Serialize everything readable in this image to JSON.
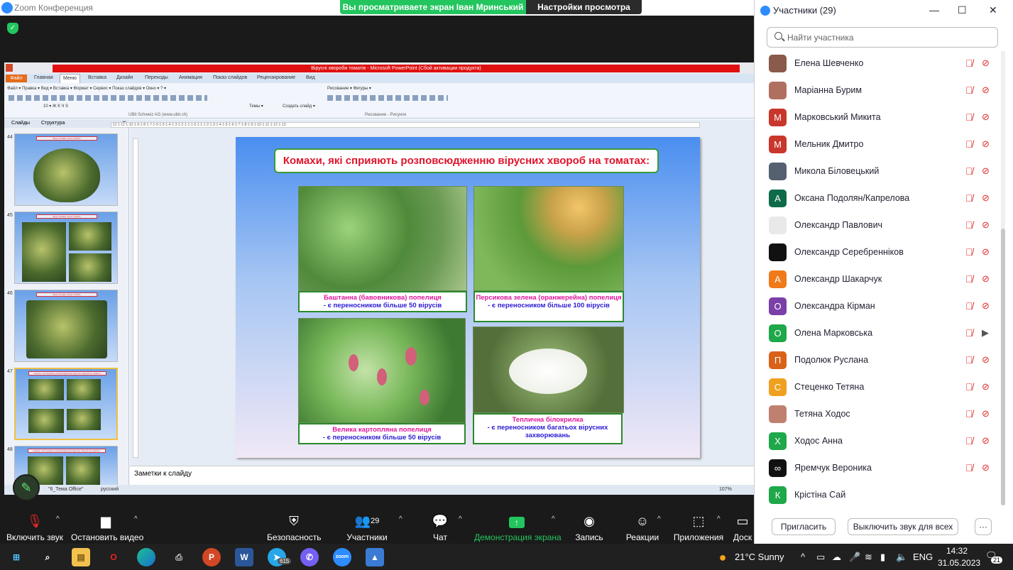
{
  "zoom": {
    "title": "Zoom Конференция",
    "banner_viewing": "Вы просматриваете экран Іван Мринський",
    "banner_settings": "Настройки просмотра"
  },
  "ppt": {
    "window_title": "Вірусні хвороби томатів  -  Microsoft PowerPoint (Сбой активации продукта)",
    "tabs": [
      "Файл",
      "Главная",
      "Меню",
      "Вставка",
      "Дизайн",
      "Переходы",
      "Анимация",
      "Показ слайдов",
      "Рецензирование",
      "Вид"
    ],
    "active_tab": "Меню",
    "menu_row": "Файл ▾   Правка ▾   Вид ▾   Вставка ▾   Формат ▾   Сервис ▾   Показ слайдов ▾   Окно ▾   ? ▾",
    "font_row": "10 ▾  Ж  К  Ч  S",
    "tools_row": "Рисование ▾     Фигуры ▾",
    "brand": "UBit Schweiz AG   (www.ubit.ch)",
    "group_drawing": "Рисование - Рисунок",
    "themes_label": "Темы ▾",
    "create_slide_label": "Создать слайд ▾",
    "pane_tab_slides": "Слайды",
    "pane_tab_structure": "Структура",
    "thumb_numbers": [
      "44",
      "45",
      "46",
      "47",
      "48"
    ],
    "thumb_header": "Вірус мозаїки пепіно (ToMV)",
    "notes_placeholder": "Заметки к слайду",
    "status_theme": "\"6_Тема Office\"",
    "status_lang": "русский",
    "status_zoom": "107%",
    "ruler": "·12·1·11·1·10·1·9·1·8·1·7·1·6·1·5·1·4·1·3·1·2·1·1·1·0·1·1·1·2·1·3·1·4·1·5·1·6·1·7·1·8·1·9·1·10·1·11·1·12·1·13·"
  },
  "slide": {
    "title": "Комахи, які сприяють розповсюдженню вірусних хвороб на томатах:",
    "captions": [
      {
        "line1": "Баштанна (бавовникова) попелиця",
        "line2": "- є переносником  більше 50 вірусів"
      },
      {
        "line1": "Персикова зелена (оранжерейна) попелиця",
        "line2": "- є переносником  більше 100 вірусів"
      },
      {
        "line1": "Велика картопляна попелиця",
        "line2": "- є переносником  більше 50 вірусів"
      },
      {
        "line1": "Теплична  білокрилка",
        "line2": "- є переносником  багатьох вірусних захворювань"
      }
    ]
  },
  "participants": {
    "title": "Участники (29)",
    "search_placeholder": "Найти участника",
    "list": [
      {
        "name": "Елена  Шевченко",
        "initial": "",
        "color": "#8a5a4a",
        "video": false
      },
      {
        "name": "Маріанна Бурим",
        "initial": "",
        "color": "#b07060",
        "video": false
      },
      {
        "name": "Марковський Микита",
        "initial": "М",
        "color": "#c9372c",
        "video": false
      },
      {
        "name": "Мельник Дмитро",
        "initial": "М",
        "color": "#c9372c",
        "video": false
      },
      {
        "name": "Микола Біловецький",
        "initial": "",
        "color": "#556070",
        "video": false
      },
      {
        "name": "Оксана Подолян/Капрелова",
        "initial": "А",
        "color": "#0e6b4a",
        "video": false
      },
      {
        "name": "Олександр Павлович",
        "initial": "",
        "color": "#e9e9e9",
        "video": false
      },
      {
        "name": "Олександр Серебренніков",
        "initial": "",
        "color": "#111111",
        "video": false
      },
      {
        "name": "Олександр Шакарчук",
        "initial": "А",
        "color": "#f07a1a",
        "video": false
      },
      {
        "name": "Олександра Кірман",
        "initial": "О",
        "color": "#7b3fa8",
        "video": false
      },
      {
        "name": "Олена Марковська",
        "initial": "О",
        "color": "#1fa84a",
        "video": true
      },
      {
        "name": "Подолюк Руслана",
        "initial": "П",
        "color": "#d9621a",
        "video": false
      },
      {
        "name": "Стеценко Тетяна",
        "initial": "С",
        "color": "#f0a020",
        "video": false
      },
      {
        "name": "Тетяна Ходос",
        "initial": "",
        "color": "#c08070",
        "video": false
      },
      {
        "name": "Ходос Анна",
        "initial": "Х",
        "color": "#1fa84a",
        "video": false
      },
      {
        "name": "Яремчук Вероника",
        "initial": "∞",
        "color": "#111111",
        "video": false
      },
      {
        "name": "Крістіна Сай",
        "initial": "К",
        "color": "#1fa84a",
        "video": null
      }
    ],
    "invite": "Пригласить",
    "mute_all": "Выключить звук для всех",
    "more": "···"
  },
  "toolbar": {
    "unmute": "Включить звук",
    "stop_video": "Остановить видео",
    "security": "Безопасность",
    "participants": "Участники",
    "participants_count": "29",
    "chat": "Чат",
    "share": "Демонстрация экрана",
    "record": "Запись",
    "reactions": "Реакции",
    "apps": "Приложения",
    "whiteboard": "Доск"
  },
  "taskbar": {
    "weather": "21°C  Sunny",
    "lang": "ENG",
    "time": "14:32",
    "date": "31.05.2023",
    "notifications": "21",
    "telegram_badge": "615"
  },
  "colors": {
    "zoom_green": "#23c55e",
    "ppt_red": "#e01010",
    "slide_title_red": "#e0142b",
    "caption_magenta": "#e0169b",
    "caption_blue": "#2a1bd4"
  }
}
